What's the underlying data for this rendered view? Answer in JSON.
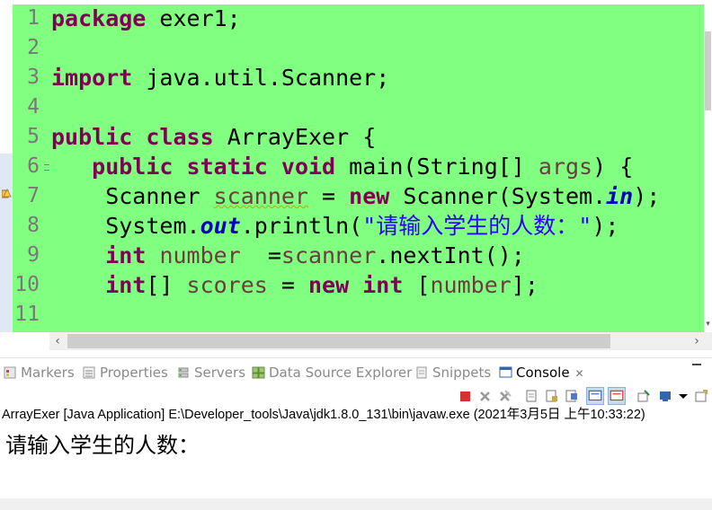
{
  "editor": {
    "lines": [
      {
        "no": "1",
        "tokens": [
          {
            "t": "package",
            "c": "kw"
          },
          {
            "t": " exer1;",
            "c": ""
          }
        ]
      },
      {
        "no": "2",
        "tokens": []
      },
      {
        "no": "3",
        "tokens": [
          {
            "t": "import",
            "c": "kw"
          },
          {
            "t": " java.util.Scanner;",
            "c": ""
          }
        ]
      },
      {
        "no": "4",
        "tokens": []
      },
      {
        "no": "5",
        "tokens": [
          {
            "t": "public",
            "c": "kw"
          },
          {
            "t": " ",
            "c": ""
          },
          {
            "t": "class",
            "c": "kw"
          },
          {
            "t": " ArrayExer {",
            "c": ""
          }
        ]
      },
      {
        "no": "6",
        "fold": true,
        "tokens": [
          {
            "t": "   ",
            "c": ""
          },
          {
            "t": "public",
            "c": "kw"
          },
          {
            "t": " ",
            "c": ""
          },
          {
            "t": "static",
            "c": "kw"
          },
          {
            "t": " ",
            "c": ""
          },
          {
            "t": "void",
            "c": "kw"
          },
          {
            "t": " main(String[] ",
            "c": ""
          },
          {
            "t": "args",
            "c": "local"
          },
          {
            "t": ") {",
            "c": ""
          }
        ]
      },
      {
        "no": "7",
        "tokens": [
          {
            "t": "    Scanner ",
            "c": ""
          },
          {
            "t": "scanner",
            "c": "unused"
          },
          {
            "t": " = ",
            "c": ""
          },
          {
            "t": "new",
            "c": "kw"
          },
          {
            "t": " Scanner(System.",
            "c": ""
          },
          {
            "t": "in",
            "c": "field"
          },
          {
            "t": ");",
            "c": ""
          }
        ]
      },
      {
        "no": "8",
        "tokens": [
          {
            "t": "    System.",
            "c": ""
          },
          {
            "t": "out",
            "c": "field"
          },
          {
            "t": ".println(",
            "c": ""
          },
          {
            "t": "\"请输入学生的人数：\"",
            "c": "str"
          },
          {
            "t": ");",
            "c": ""
          }
        ]
      },
      {
        "no": "9",
        "tokens": [
          {
            "t": "    ",
            "c": ""
          },
          {
            "t": "int",
            "c": "kw"
          },
          {
            "t": " ",
            "c": ""
          },
          {
            "t": "number",
            "c": "local"
          },
          {
            "t": "  =",
            "c": ""
          },
          {
            "t": "scanner",
            "c": "local"
          },
          {
            "t": ".nextInt();",
            "c": ""
          }
        ]
      },
      {
        "no": "10",
        "tokens": [
          {
            "t": "    ",
            "c": ""
          },
          {
            "t": "int",
            "c": "kw"
          },
          {
            "t": "[] ",
            "c": ""
          },
          {
            "t": "scores",
            "c": "local"
          },
          {
            "t": " = ",
            "c": ""
          },
          {
            "t": "new",
            "c": "kw"
          },
          {
            "t": " ",
            "c": ""
          },
          {
            "t": "int",
            "c": "kw"
          },
          {
            "t": " [",
            "c": ""
          },
          {
            "t": "number",
            "c": "local"
          },
          {
            "t": "];",
            "c": ""
          }
        ]
      },
      {
        "no": "11",
        "tokens": []
      }
    ]
  },
  "panel": {
    "tabs": [
      {
        "label": "Markers",
        "icon": "markers-icon"
      },
      {
        "label": "Properties",
        "icon": "properties-icon"
      },
      {
        "label": "Servers",
        "icon": "servers-icon"
      },
      {
        "label": "Data Source Explorer",
        "icon": "data-source-icon"
      },
      {
        "label": "Snippets",
        "icon": "snippets-icon"
      },
      {
        "label": "Console",
        "icon": "console-icon",
        "active": true
      }
    ],
    "close_glyph": "✕",
    "console_header": "ArrayExer [Java Application] E:\\Developer_tools\\Java\\jdk1.8.0_131\\bin\\javaw.exe (2021年3月5日 上午10:33:22)",
    "console_output": "请输入学生的人数："
  },
  "colors": {
    "editor_bg": "#80ff80",
    "keyword": "#7f0055",
    "string": "#2a00ff",
    "field": "#0000c0",
    "line_number": "#787878"
  }
}
